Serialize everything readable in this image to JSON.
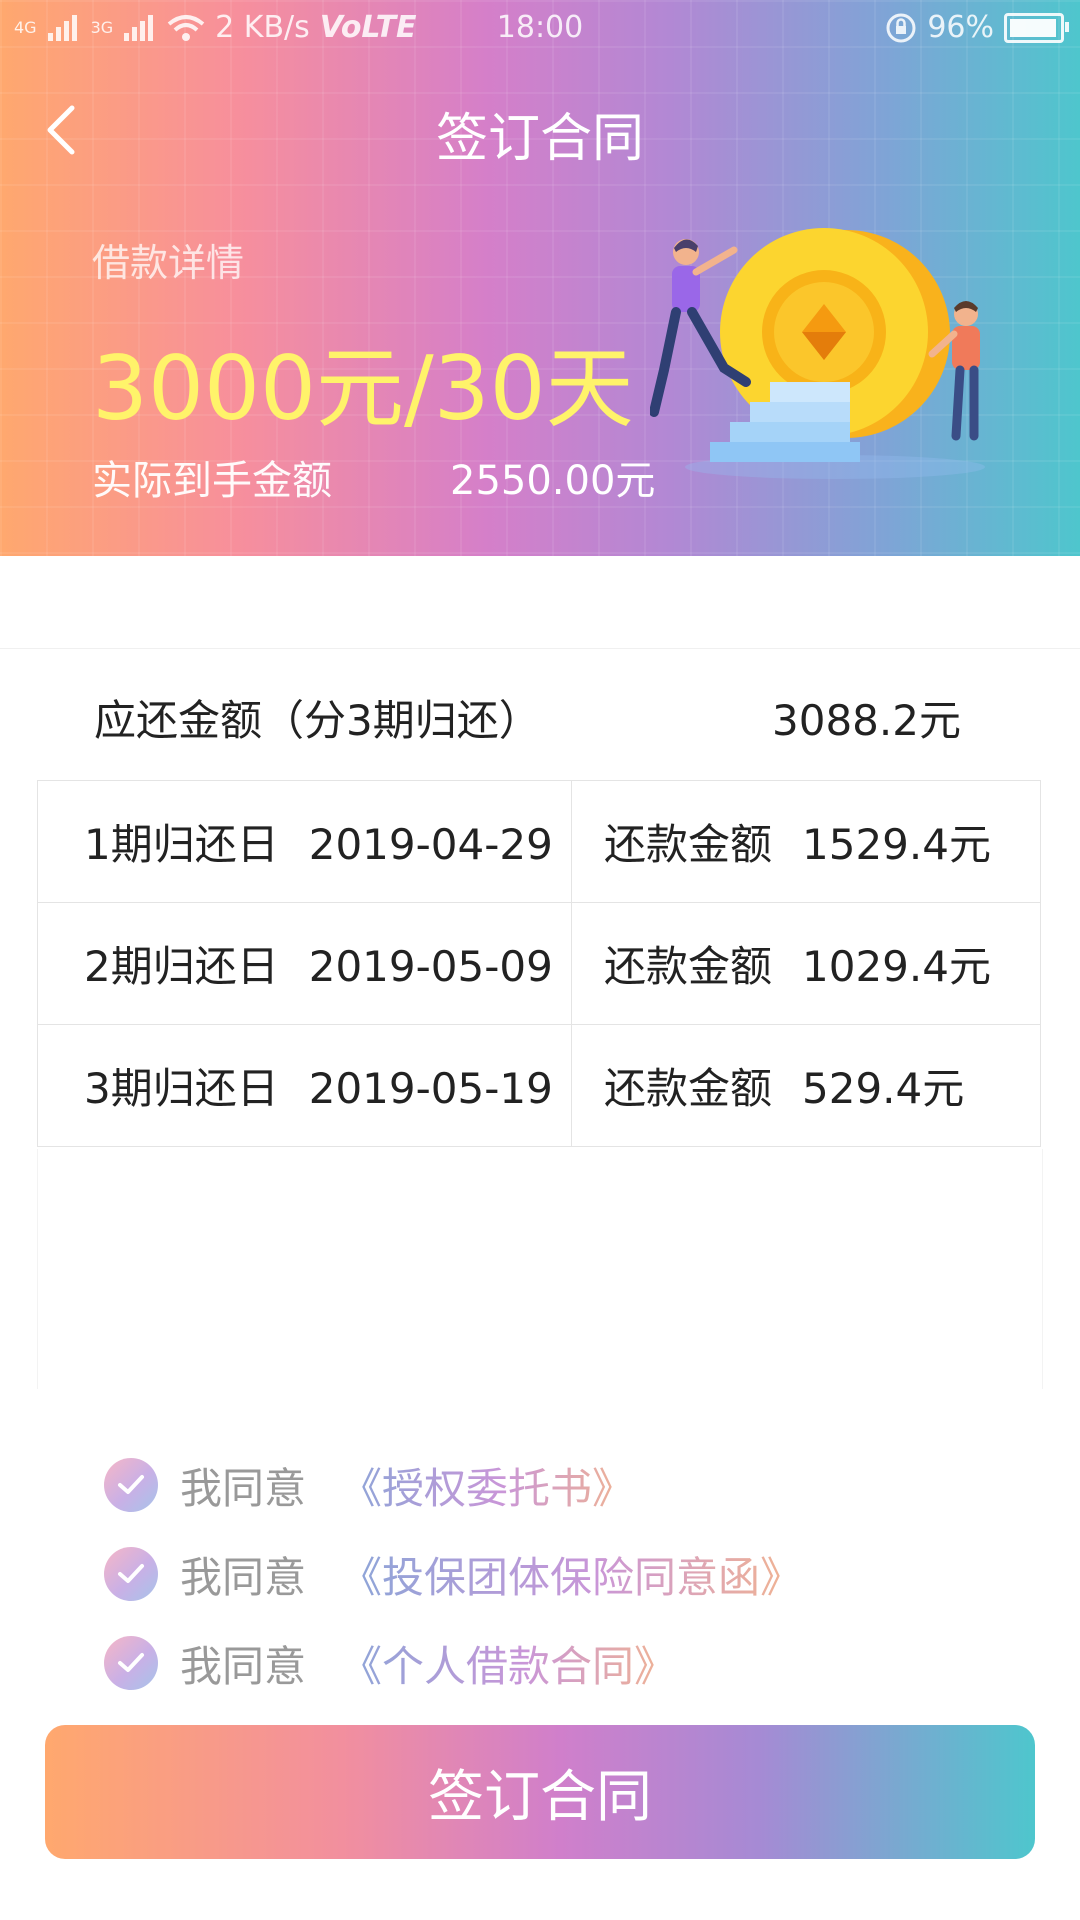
{
  "status_bar": {
    "net1": "4G",
    "net2": "3G",
    "speed": "2 KB/s",
    "volte": "VoLTE",
    "time": "18:00",
    "battery": "96%",
    "battery_level": 0.96
  },
  "header": {
    "title": "签订合同",
    "loan_label": "借款详情",
    "loan_amount": "3000元/30天",
    "received_label": "实际到手金额",
    "received_value": "2550.00元"
  },
  "summary": {
    "due_label": "应还金额（分3期归还）",
    "due_value": "3088.2元"
  },
  "installments": [
    {
      "period": "1期归还日",
      "date": "2019-04-29",
      "amount_label": "还款金额",
      "amount": "1529.4元"
    },
    {
      "period": "2期归还日",
      "date": "2019-05-09",
      "amount_label": "还款金额",
      "amount": "1029.4元"
    },
    {
      "period": "3期归还日",
      "date": "2019-05-19",
      "amount_label": "还款金额",
      "amount": "529.4元"
    }
  ],
  "agreements": [
    {
      "agree": "我同意",
      "doc": "《授权委托书》",
      "checked": true
    },
    {
      "agree": "我同意",
      "doc": "《投保团体保险同意函》",
      "checked": true
    },
    {
      "agree": "我同意",
      "doc": "《个人借款合同》",
      "checked": true
    }
  ],
  "sign_button": "签订合同",
  "colors": {
    "gradient_start": "#ffa86e",
    "gradient_mid": "#d57fc9",
    "gradient_end": "#4ec6cd",
    "highlight_amount": "#fff36a"
  }
}
